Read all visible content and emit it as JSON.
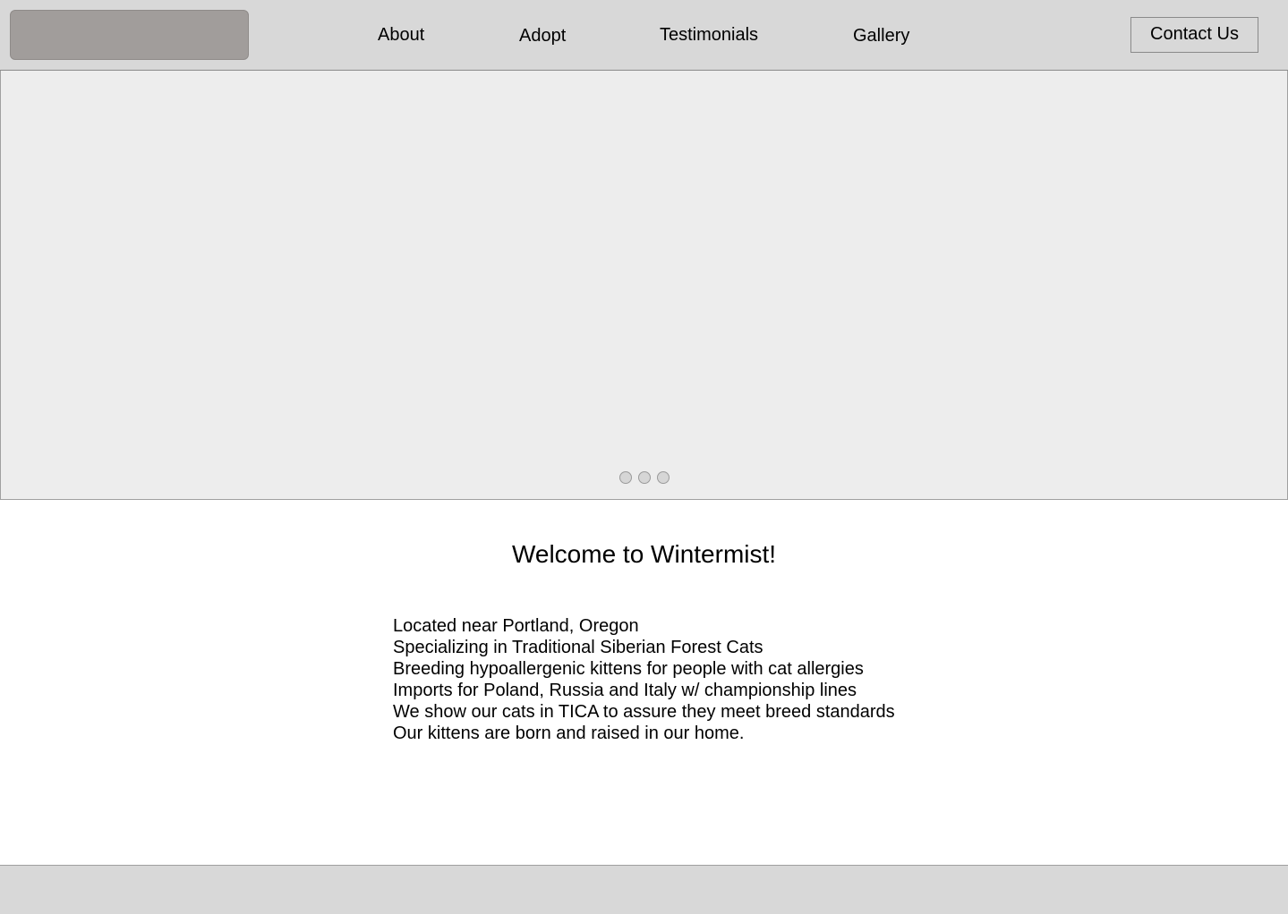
{
  "header": {
    "nav": {
      "about": "About",
      "adopt": "Adopt",
      "testimonials": "Testimonials",
      "gallery": "Gallery"
    },
    "contact_label": "Contact Us"
  },
  "hero": {
    "slide_count": 3
  },
  "main": {
    "welcome_title": "Welcome to Wintermist!",
    "info": [
      "Located near Portland, Oregon",
      "Specializing in Traditional Siberian Forest Cats",
      "Breeding hypoallergenic kittens for people with cat allergies",
      "Imports for Poland, Russia and Italy w/ championship lines",
      "We show our cats in TICA to assure they meet breed standards",
      "Our kittens are born and raised in our home."
    ]
  },
  "colors": {
    "header_bg": "#d8d8d8",
    "logo_placeholder": "#a19d9b",
    "hero_bg": "#ededed",
    "footer_bg": "#d8d8d8"
  }
}
